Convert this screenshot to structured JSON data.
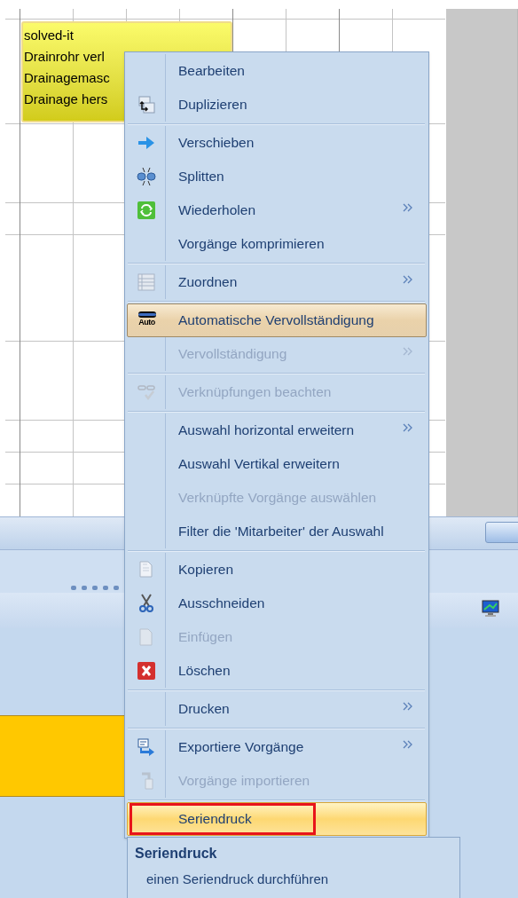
{
  "task_card": {
    "lines": [
      "solved-it",
      "Drainrohr verl",
      "Drainagemasc",
      "Drainage hers"
    ]
  },
  "context_menu": {
    "groups": [
      {
        "items": [
          {
            "label": "Bearbeiten",
            "disabled": false,
            "submenu": false,
            "checked": false,
            "selected": false,
            "outlined": false
          },
          {
            "label": "Duplizieren",
            "disabled": false,
            "submenu": false,
            "checked": false,
            "selected": false,
            "outlined": false
          }
        ]
      },
      {
        "items": [
          {
            "label": "Verschieben",
            "disabled": false,
            "submenu": false,
            "checked": false,
            "selected": false,
            "outlined": false
          },
          {
            "label": "Splitten",
            "disabled": false,
            "submenu": false,
            "checked": false,
            "selected": false,
            "outlined": false
          },
          {
            "label": "Wiederholen",
            "disabled": false,
            "submenu": true,
            "checked": false,
            "selected": false,
            "outlined": false
          },
          {
            "label": "Vorgänge komprimieren",
            "disabled": false,
            "submenu": false,
            "checked": false,
            "selected": false,
            "outlined": false
          }
        ]
      },
      {
        "items": [
          {
            "label": "Zuordnen",
            "disabled": false,
            "submenu": true,
            "checked": false,
            "selected": false,
            "outlined": false
          }
        ]
      },
      {
        "items": [
          {
            "label": "Automatische Vervollständigung",
            "icon_label": "Auto",
            "disabled": false,
            "submenu": false,
            "checked": true,
            "selected": false,
            "outlined": false
          },
          {
            "label": "Vervollständigung",
            "disabled": true,
            "submenu": true,
            "checked": false,
            "selected": false,
            "outlined": false
          }
        ]
      },
      {
        "items": [
          {
            "label": "Verknüpfungen beachten",
            "disabled": true,
            "submenu": false,
            "checked": false,
            "selected": false,
            "outlined": false
          }
        ]
      },
      {
        "items": [
          {
            "label": "Auswahl horizontal erweitern",
            "disabled": false,
            "submenu": true,
            "checked": false,
            "selected": false,
            "outlined": false
          },
          {
            "label": "Auswahl Vertikal erweitern",
            "disabled": false,
            "submenu": false,
            "checked": false,
            "selected": false,
            "outlined": false
          },
          {
            "label": "Verknüpfte Vorgänge auswählen",
            "disabled": true,
            "submenu": false,
            "checked": false,
            "selected": false,
            "outlined": false
          },
          {
            "label": "Filter die 'Mitarbeiter' der Auswahl",
            "disabled": false,
            "submenu": false,
            "checked": false,
            "selected": false,
            "outlined": false
          }
        ]
      },
      {
        "items": [
          {
            "label": "Kopieren",
            "disabled": false,
            "submenu": false,
            "checked": false,
            "selected": false,
            "outlined": false
          },
          {
            "label": "Ausschneiden",
            "disabled": false,
            "submenu": false,
            "checked": false,
            "selected": false,
            "outlined": false
          },
          {
            "label": "Einfügen",
            "disabled": true,
            "submenu": false,
            "checked": false,
            "selected": false,
            "outlined": false
          },
          {
            "label": "Löschen",
            "disabled": false,
            "submenu": false,
            "checked": false,
            "selected": false,
            "outlined": false
          }
        ]
      },
      {
        "items": [
          {
            "label": "Drucken",
            "disabled": false,
            "submenu": true,
            "checked": false,
            "selected": false,
            "outlined": false
          }
        ]
      },
      {
        "items": [
          {
            "label": "Exportiere Vorgänge",
            "disabled": false,
            "submenu": true,
            "checked": false,
            "selected": false,
            "outlined": false
          },
          {
            "label": "Vorgänge importieren",
            "disabled": true,
            "submenu": false,
            "checked": false,
            "selected": false,
            "outlined": false
          }
        ]
      },
      {
        "items": [
          {
            "label": "Seriendruck",
            "disabled": false,
            "submenu": false,
            "checked": false,
            "selected": true,
            "outlined": true
          }
        ]
      }
    ]
  },
  "tooltip": {
    "title": "Seriendruck",
    "text": "einen Seriendruck durchführen"
  }
}
